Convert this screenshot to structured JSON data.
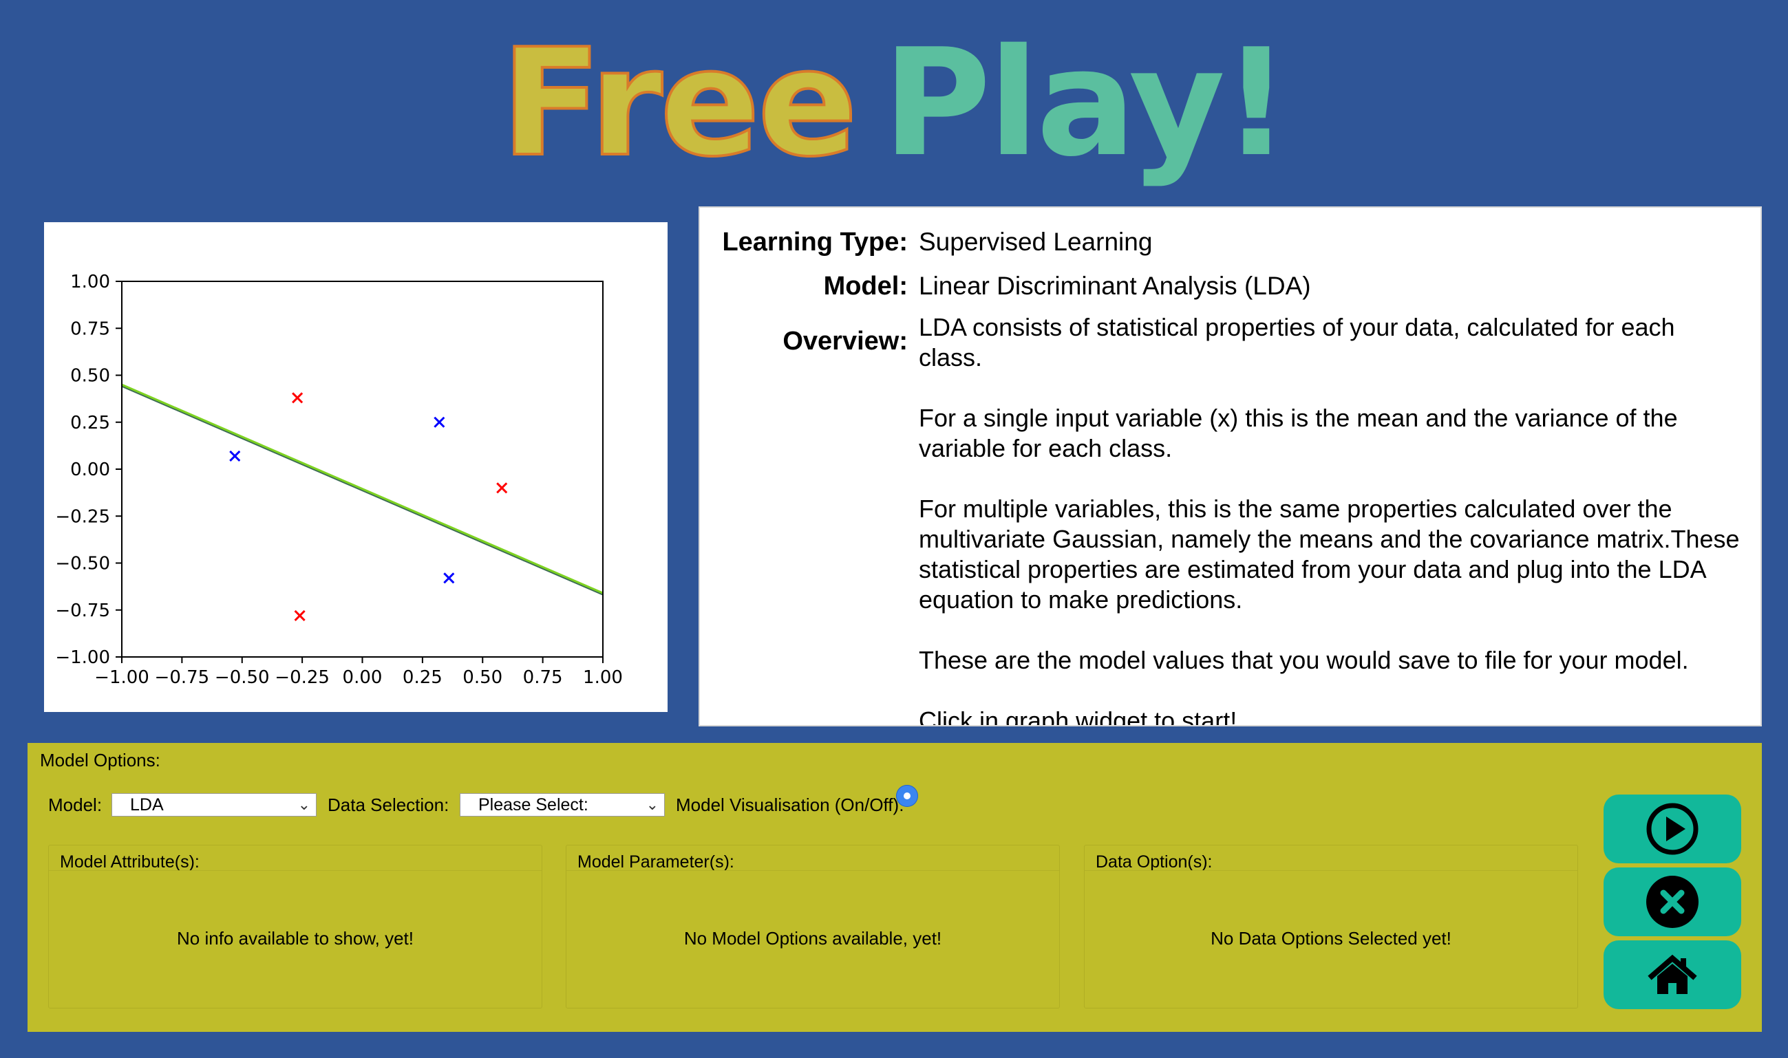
{
  "title": {
    "word1": "Free",
    "word2": "Play!"
  },
  "info": {
    "learning_type_label": "Learning Type:",
    "learning_type_value": "Supervised Learning",
    "model_label": "Model:",
    "model_value": "Linear Discriminant Analysis (LDA)",
    "overview_label": "Overview:",
    "overview_text": "LDA consists of statistical properties of your data, calculated for each class.\n\nFor a single input variable (x) this is the mean and the variance of the variable for each class.\n\nFor multiple variables, this is the same properties calculated over the multivariate Gaussian, namely the means and the covariance matrix.These statistical properties are estimated from your data and plug into the LDA equation to make predictions.\n\nThese are the model values that you would save to file for your model.\n\nClick in graph widget to start!"
  },
  "options": {
    "panel_title": "Model Options:",
    "model_label": "Model:",
    "model_selected": "LDA",
    "data_label": "Data Selection:",
    "data_selected": "Please Select:",
    "viz_label": "Model Visualisation (On/Off):",
    "attributes_title": "Model Attribute(s):",
    "attributes_msg": "No info available to show, yet!",
    "parameters_title": "Model Parameter(s):",
    "parameters_msg": "No Model Options available, yet!",
    "data_options_title": "Data Option(s):",
    "data_options_msg": "No Data Options Selected yet!"
  },
  "buttons": {
    "play_icon": "play-circle-icon",
    "close_icon": "close-circle-icon",
    "home_icon": "home-icon"
  },
  "colors": {
    "background": "#2f5597",
    "options_bg": "#bfbd2a",
    "button_bg": "#12b89a",
    "title_free": "#c9bd40",
    "title_play": "#5bbf9f",
    "class_red": "#ff0000",
    "class_blue": "#0000ff",
    "boundary": "#7ed321"
  },
  "chart_data": {
    "type": "scatter",
    "xlim": [
      -1.0,
      1.0
    ],
    "ylim": [
      -1.0,
      1.0
    ],
    "xticks": [
      -1.0,
      -0.75,
      -0.5,
      -0.25,
      0.0,
      0.25,
      0.5,
      0.75,
      1.0
    ],
    "yticks": [
      -1.0,
      -0.75,
      -0.5,
      -0.25,
      0.0,
      0.25,
      0.5,
      0.75,
      1.0
    ],
    "xtick_labels": [
      "−1.00",
      "−0.75",
      "−0.50",
      "−0.25",
      "0.00",
      "0.25",
      "0.50",
      "0.75",
      "1.00"
    ],
    "ytick_labels": [
      "−1.00",
      "−0.75",
      "−0.50",
      "−0.25",
      "0.00",
      "0.25",
      "0.50",
      "0.75",
      "1.00"
    ],
    "series": [
      {
        "color": "#ff0000",
        "marker": "x",
        "points": [
          [
            -0.27,
            0.38
          ],
          [
            0.58,
            -0.1
          ],
          [
            -0.26,
            -0.78
          ]
        ]
      },
      {
        "color": "#0000ff",
        "marker": "x",
        "points": [
          [
            -0.53,
            0.07
          ],
          [
            0.32,
            0.25
          ],
          [
            0.36,
            -0.58
          ]
        ]
      }
    ],
    "decision_boundary": {
      "color": "#7ed321",
      "points": [
        [
          -1.0,
          0.45
        ],
        [
          1.0,
          -0.66
        ]
      ]
    },
    "grid": false
  }
}
